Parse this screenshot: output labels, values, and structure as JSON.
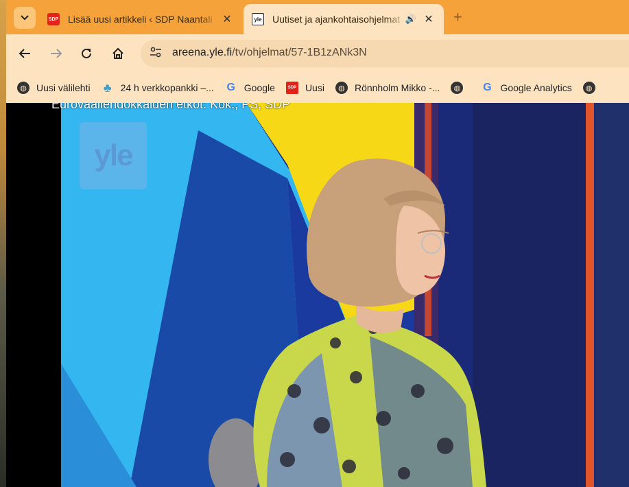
{
  "tabs": [
    {
      "title": "Lisää uusi artikkeli ‹ SDP Naantali",
      "favicon": "sdp-icon",
      "active": false
    },
    {
      "title": "Uutiset ja ajankohtaisohjelmat",
      "favicon": "yle-icon",
      "active": true,
      "audio": true
    }
  ],
  "toolbar": {
    "url_domain": "areena.yle.fi",
    "url_path": "/tv/ohjelmat/57-1B1zANk3N"
  },
  "bookmarks": [
    {
      "label": "Uusi välilehti",
      "icon": "globe-icon"
    },
    {
      "label": "24 h verkkopankki –...",
      "icon": "clover-icon"
    },
    {
      "label": "Google",
      "icon": "google-icon"
    },
    {
      "label": "Uusi",
      "icon": "sdp-icon"
    },
    {
      "label": "Rönnholm Mikko -...",
      "icon": "globe-icon"
    },
    {
      "label": "",
      "icon": "globe-icon"
    },
    {
      "label": "Google Analytics",
      "icon": "google-icon"
    },
    {
      "label": "",
      "icon": "globe-icon"
    }
  ],
  "video": {
    "caption": "Eurovaaliehdokkaiden etkot: Kok., PS, SDP",
    "logo_text": "yle"
  },
  "colors": {
    "tabstrip": "#f6a23a",
    "toolbar": "#fde3c0",
    "accent_red": "#e2231a"
  }
}
